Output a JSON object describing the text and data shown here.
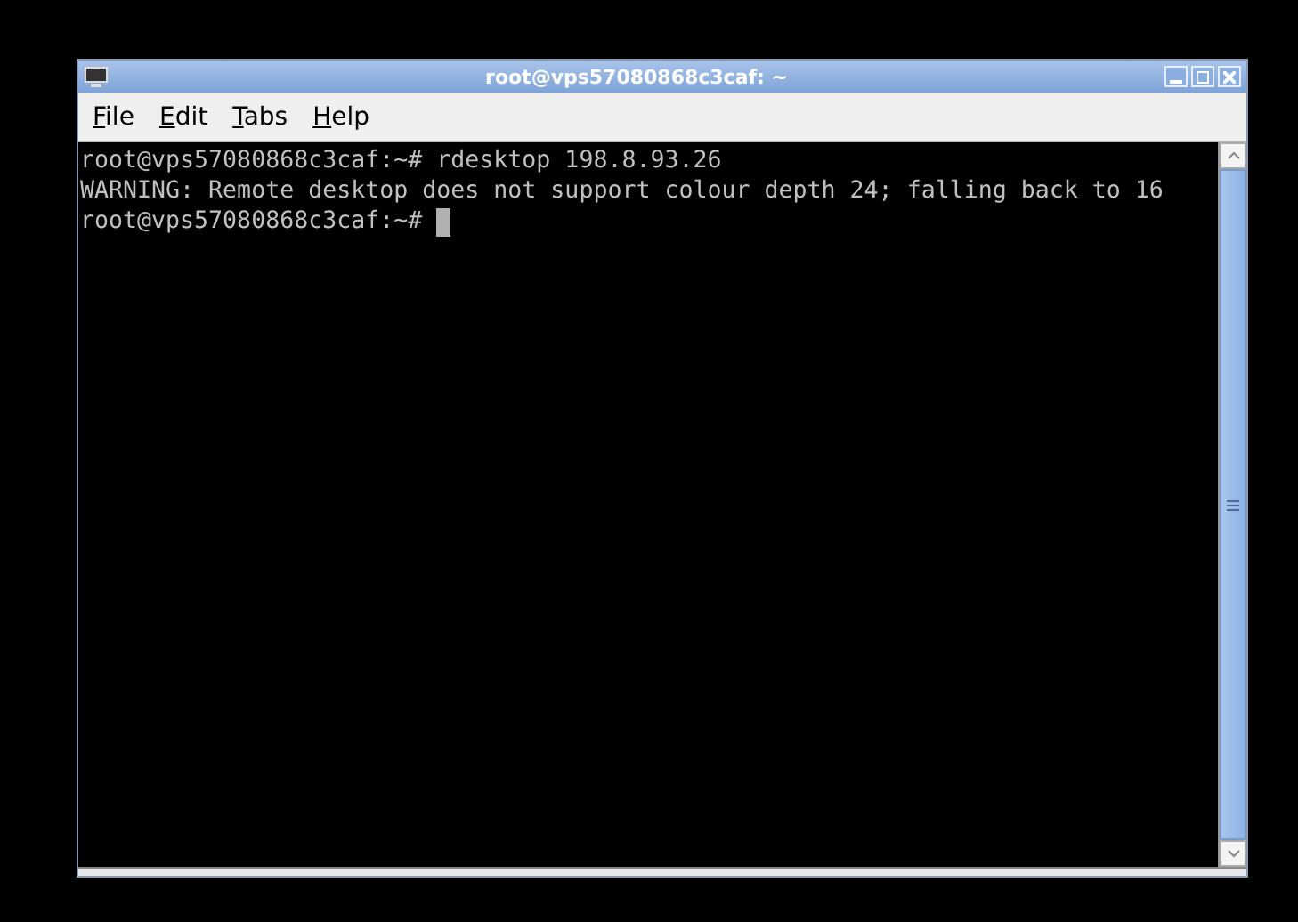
{
  "window": {
    "title": "root@vps57080868c3caf: ~"
  },
  "menu": [
    {
      "mnemonic": "F",
      "rest": "ile"
    },
    {
      "mnemonic": "E",
      "rest": "dit"
    },
    {
      "mnemonic": "T",
      "rest": "abs"
    },
    {
      "mnemonic": "H",
      "rest": "elp"
    }
  ],
  "terminal": {
    "lines": [
      {
        "text": "root@vps57080868c3caf:~# rdesktop 198.8.93.26",
        "cursor": false
      },
      {
        "text": "WARNING: Remote desktop does not support colour depth 24; falling back to 16",
        "cursor": false
      },
      {
        "text": "root@vps57080868c3caf:~# ",
        "cursor": true
      }
    ]
  }
}
